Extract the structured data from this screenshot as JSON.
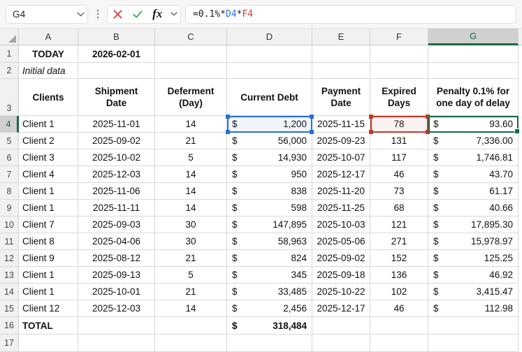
{
  "formula_bar": {
    "name_box_value": "G4",
    "name_box_icon": "chevron-down-icon",
    "menu_icon": "kebab-menu-icon",
    "cancel_icon": "cancel-x-icon",
    "confirm_icon": "confirm-check-icon",
    "function_icon": "fx-icon",
    "function_chevron_icon": "chevron-down-icon",
    "formula_prefix": "=0.1%*",
    "formula_ref1": "D4",
    "formula_mid": "*",
    "formula_ref2": "F4",
    "formula_full": "=0.1%*D4*F4"
  },
  "grid": {
    "column_headers": [
      "A",
      "B",
      "C",
      "D",
      "E",
      "F",
      "G"
    ],
    "active_column": "G",
    "row_headers": [
      "1",
      "2",
      "3",
      "4",
      "5",
      "6",
      "7",
      "8",
      "9",
      "10",
      "11",
      "12",
      "13",
      "14",
      "15",
      "16",
      "17"
    ],
    "active_row": "4",
    "active_cell": "G4",
    "precedent_cells": [
      "D4",
      "F4"
    ]
  },
  "sheet": {
    "row1": {
      "a": "TODAY",
      "b": "2026-02-01"
    },
    "row2": {
      "a": "Initial data"
    },
    "headers": {
      "a": "Clients",
      "b": "Shipment Date",
      "b_line1": "Shipment",
      "b_line2": "Date",
      "c": "Deferment (Day)",
      "c_line1": "Deferment",
      "c_line2": "(Day)",
      "d": "Current Debt",
      "e": "Payment Date",
      "e_line1": "Payment",
      "e_line2": "Date",
      "f": "Expired Days",
      "f_line1": "Expired",
      "f_line2": "Days",
      "g": "Penalty 0.1% for one day of delay",
      "g_line1": "Penalty 0.1% for",
      "g_line2": "one day of delay"
    },
    "currency_symbol": "$",
    "rows": [
      {
        "row": "4",
        "client": "Client 1",
        "shipment": "2025-11-01",
        "deferment": "14",
        "debt": "1,200",
        "payment": "2025-11-15",
        "expired": "78",
        "penalty": "93.60"
      },
      {
        "row": "5",
        "client": "Client 2",
        "shipment": "2025-09-02",
        "deferment": "21",
        "debt": "56,000",
        "payment": "2025-09-23",
        "expired": "131",
        "penalty": "7,336.00"
      },
      {
        "row": "6",
        "client": "Client 3",
        "shipment": "2025-10-02",
        "deferment": "5",
        "debt": "14,930",
        "payment": "2025-10-07",
        "expired": "117",
        "penalty": "1,746.81"
      },
      {
        "row": "7",
        "client": "Client 4",
        "shipment": "2025-12-03",
        "deferment": "14",
        "debt": "950",
        "payment": "2025-12-17",
        "expired": "46",
        "penalty": "43.70"
      },
      {
        "row": "8",
        "client": "Client 1",
        "shipment": "2025-11-06",
        "deferment": "14",
        "debt": "838",
        "payment": "2025-11-20",
        "expired": "73",
        "penalty": "61.17"
      },
      {
        "row": "9",
        "client": "Client 1",
        "shipment": "2025-11-11",
        "deferment": "14",
        "debt": "598",
        "payment": "2025-11-25",
        "expired": "68",
        "penalty": "40.66"
      },
      {
        "row": "10",
        "client": "Client 7",
        "shipment": "2025-09-03",
        "deferment": "30",
        "debt": "147,895",
        "payment": "2025-10-03",
        "expired": "121",
        "penalty": "17,895.30"
      },
      {
        "row": "11",
        "client": "Client 8",
        "shipment": "2025-04-06",
        "deferment": "30",
        "debt": "58,963",
        "payment": "2025-05-06",
        "expired": "271",
        "penalty": "15,978.97"
      },
      {
        "row": "12",
        "client": "Client 9",
        "shipment": "2025-08-12",
        "deferment": "21",
        "debt": "824",
        "payment": "2025-09-02",
        "expired": "152",
        "penalty": "125.25"
      },
      {
        "row": "13",
        "client": "Client 1",
        "shipment": "2025-09-13",
        "deferment": "5",
        "debt": "345",
        "payment": "2025-09-18",
        "expired": "136",
        "penalty": "46.92"
      },
      {
        "row": "14",
        "client": "Client 1",
        "shipment": "2025-10-01",
        "deferment": "21",
        "debt": "33,485",
        "payment": "2025-10-22",
        "expired": "102",
        "penalty": "3,415.47"
      },
      {
        "row": "15",
        "client": "Client 12",
        "shipment": "2025-12-03",
        "deferment": "14",
        "debt": "2,456",
        "payment": "2025-12-17",
        "expired": "46",
        "penalty": "112.98"
      }
    ],
    "total": {
      "label": "TOTAL",
      "debt": "318,484"
    }
  },
  "colors": {
    "active_green": "#156b45",
    "precedent_blue": "#2a6fd6",
    "precedent_red": "#c0392b",
    "header_gray": "#f1f1f1",
    "active_header_gray": "#d0d0d0"
  }
}
